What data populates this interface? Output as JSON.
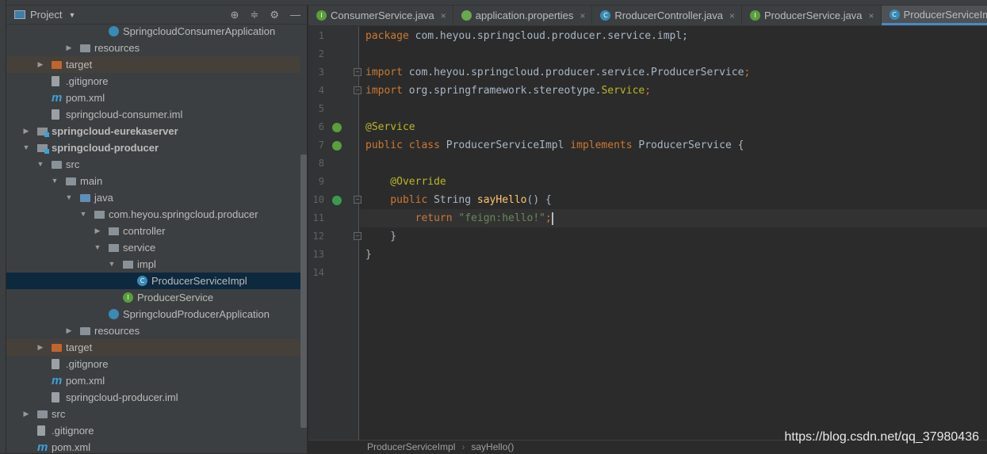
{
  "project_panel": {
    "title": "Project",
    "tools": [
      "locate-icon",
      "collapse-icon",
      "gear-icon",
      "minimize-icon"
    ]
  },
  "tree": [
    {
      "label": "SpringcloudConsumerApplication",
      "level": 6,
      "icon": "spring-app-icon"
    },
    {
      "label": "resources",
      "level": 4,
      "icon": "resources-folder-icon",
      "arrow": "collapsed"
    },
    {
      "label": "target",
      "level": 2,
      "icon": "target-folder-icon",
      "arrow": "collapsed",
      "highlight": true
    },
    {
      "label": ".gitignore",
      "level": 2,
      "icon": "file-icon"
    },
    {
      "label": "pom.xml",
      "level": 2,
      "icon": "maven-icon"
    },
    {
      "label": "springcloud-consumer.iml",
      "level": 2,
      "icon": "file-icon"
    },
    {
      "label": "springcloud-eurekaserver",
      "level": 1,
      "icon": "module-icon",
      "arrow": "collapsed",
      "bold": true
    },
    {
      "label": "springcloud-producer",
      "level": 1,
      "icon": "module-icon",
      "arrow": "expanded",
      "bold": true
    },
    {
      "label": "src",
      "level": 2,
      "icon": "folder-icon",
      "arrow": "expanded"
    },
    {
      "label": "main",
      "level": 3,
      "icon": "folder-icon",
      "arrow": "expanded"
    },
    {
      "label": "java",
      "level": 4,
      "icon": "source-folder-icon",
      "arrow": "expanded"
    },
    {
      "label": "com.heyou.springcloud.producer",
      "level": 5,
      "icon": "package-icon",
      "arrow": "expanded"
    },
    {
      "label": "controller",
      "level": 6,
      "icon": "package-icon",
      "arrow": "collapsed"
    },
    {
      "label": "service",
      "level": 6,
      "icon": "package-icon",
      "arrow": "expanded"
    },
    {
      "label": "impl",
      "level": 7,
      "icon": "package-icon",
      "arrow": "expanded"
    },
    {
      "label": "ProducerServiceImpl",
      "level": 8,
      "icon": "class-icon",
      "selected": true
    },
    {
      "label": "ProducerService",
      "level": 7,
      "icon": "interface-icon"
    },
    {
      "label": "SpringcloudProducerApplication",
      "level": 6,
      "icon": "spring-app-icon"
    },
    {
      "label": "resources",
      "level": 4,
      "icon": "resources-folder-icon",
      "arrow": "collapsed"
    },
    {
      "label": "target",
      "level": 2,
      "icon": "target-folder-icon",
      "arrow": "collapsed",
      "highlight": true
    },
    {
      "label": ".gitignore",
      "level": 2,
      "icon": "file-icon"
    },
    {
      "label": "pom.xml",
      "level": 2,
      "icon": "maven-icon"
    },
    {
      "label": "springcloud-producer.iml",
      "level": 2,
      "icon": "file-icon"
    },
    {
      "label": "src",
      "level": 1,
      "icon": "folder-icon",
      "arrow": "collapsed"
    },
    {
      "label": ".gitignore",
      "level": 1,
      "icon": "file-icon"
    },
    {
      "label": "pom.xml",
      "level": 1,
      "icon": "maven-icon"
    }
  ],
  "tabs": [
    {
      "label": "ConsumerService.java",
      "icon": "interface-icon",
      "letter": "I"
    },
    {
      "label": "application.properties",
      "icon": "spring-icon",
      "letter": ""
    },
    {
      "label": "RroducerController.java",
      "icon": "class-icon",
      "letter": "C"
    },
    {
      "label": "ProducerService.java",
      "icon": "interface-icon",
      "letter": "I"
    },
    {
      "label": "ProducerServiceImpl",
      "icon": "class-icon",
      "letter": "C",
      "active": true
    }
  ],
  "code": [
    [
      [
        "kw",
        "package "
      ],
      [
        "df",
        "com.heyou.springcloud.producer.service.impl;"
      ]
    ],
    [],
    [
      [
        "kw",
        "import "
      ],
      [
        "df",
        "com.heyou.springcloud.producer.service.ProducerService"
      ],
      [
        "kw",
        ";"
      ]
    ],
    [
      [
        "kw",
        "import "
      ],
      [
        "df",
        "org.springframework.stereotype."
      ],
      [
        "an",
        "Service"
      ],
      [
        "kw",
        ";"
      ]
    ],
    [],
    [
      [
        "an",
        "@Service"
      ]
    ],
    [
      [
        "kw",
        "public class "
      ],
      [
        "df",
        "ProducerServiceImpl "
      ],
      [
        "kw",
        "implements "
      ],
      [
        "df",
        "ProducerService {"
      ]
    ],
    [],
    [
      [
        "an",
        "    @Override"
      ]
    ],
    [
      [
        "kw",
        "    public "
      ],
      [
        "df",
        "String "
      ],
      [
        "me",
        "sayHello"
      ],
      [
        "df",
        "() {"
      ]
    ],
    [
      [
        "kw",
        "        return "
      ],
      [
        "st",
        "\"feign:hello!\""
      ],
      [
        "kw",
        ";"
      ]
    ],
    [
      [
        "df",
        "    }"
      ]
    ],
    [
      [
        "df",
        "}"
      ]
    ],
    []
  ],
  "breadcrumb": [
    "ProducerServiceImpl",
    "sayHello()"
  ],
  "watermark": "https://blog.csdn.net/qq_37980436",
  "colors": {
    "keyword": "#cc7832",
    "annotation": "#bbb529",
    "string": "#6a8759",
    "method": "#ffc66d",
    "selection": "#0d293e",
    "accent": "#4a88c7"
  }
}
